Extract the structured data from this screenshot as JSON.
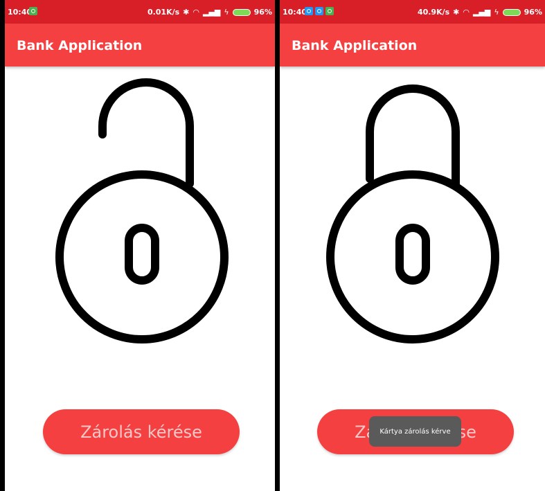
{
  "screens": [
    {
      "status_bar": {
        "time": "10:40",
        "network_speed": "0.01K/s",
        "battery_percent": "96%"
      },
      "app_bar": {
        "title": "Bank Application"
      },
      "lock_state": "unlocked",
      "button": {
        "label": "Zárolás kérése"
      }
    },
    {
      "status_bar": {
        "time": "10:40",
        "network_speed": "40.9K/s",
        "battery_percent": "96%"
      },
      "app_bar": {
        "title": "Bank Application"
      },
      "lock_state": "locked",
      "button": {
        "label": "Zárolás kérése"
      },
      "toast": {
        "text": "Kártya zárolás kérve"
      }
    }
  ],
  "icons": {
    "notifications_left": [
      "app-notification-icon"
    ],
    "notifications_right": [
      "messenger-icon",
      "messenger-icon",
      "app-notification-icon"
    ],
    "status": [
      "bluetooth-icon",
      "wifi-icon",
      "signal-icon",
      "charging-icon",
      "battery-icon"
    ]
  },
  "colors": {
    "status_bar": "#d81f27",
    "app_bar": "#f44040",
    "button": "#f44040",
    "button_text": "#f9c7c7",
    "toast": "#5a5a5a",
    "lock_stroke": "#000000",
    "background": "#ffffff"
  }
}
